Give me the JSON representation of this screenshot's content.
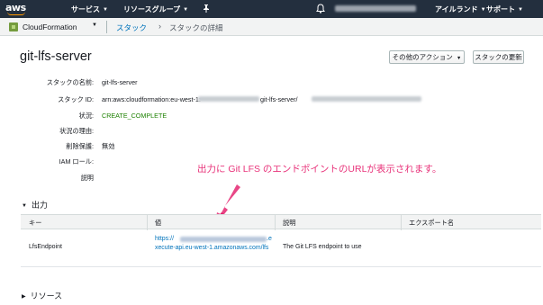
{
  "nav": {
    "logo": "aws",
    "services": "サービス",
    "resource_groups": "リソースグループ",
    "bell_icon": "bell-icon",
    "region": "アイルランド",
    "support": "サポート"
  },
  "service_bar": {
    "service_name": "CloudFormation",
    "breadcrumb_link": "スタック",
    "breadcrumb_current": "スタックの詳細"
  },
  "header": {
    "title": "git-lfs-server",
    "actions_button": "その他のアクション",
    "update_button": "スタックの更新"
  },
  "details": {
    "stack_name_label": "スタックの名前:",
    "stack_name_value": "git-lfs-server",
    "stack_id_label": "スタック ID:",
    "stack_id_prefix": "arn:aws:cloudformation:eu-west-1:",
    "stack_id_middle": "git-lfs-server/",
    "status_label": "状況:",
    "status_value": "CREATE_COMPLETE",
    "status_reason_label": "状況の理由:",
    "termination_label": "削除保護:",
    "termination_value": "無効",
    "iam_role_label": "IAM ロール:",
    "description_label": "説明"
  },
  "annotation": "出力に Git LFS のエンドポイントのURLが表示されます。",
  "outputs": {
    "section_label": "出力",
    "columns": [
      "キー",
      "値",
      "説明",
      "エクスポート名"
    ],
    "rows": [
      {
        "key": "LfsEndpoint",
        "value_line1_start": "https://",
        "value_line1_end": ".e",
        "value_line2": "xecute-api.eu-west-1.amazonaws.com/lfs",
        "description": "The Git LFS endpoint to use"
      }
    ]
  },
  "resources": {
    "section_label": "リソース"
  },
  "colors": {
    "nav_bg": "#232f3e",
    "aws_orange": "#ff9900",
    "link_blue": "#0073bb",
    "status_green": "#1d8102",
    "annotation_pink": "#e8337a"
  }
}
